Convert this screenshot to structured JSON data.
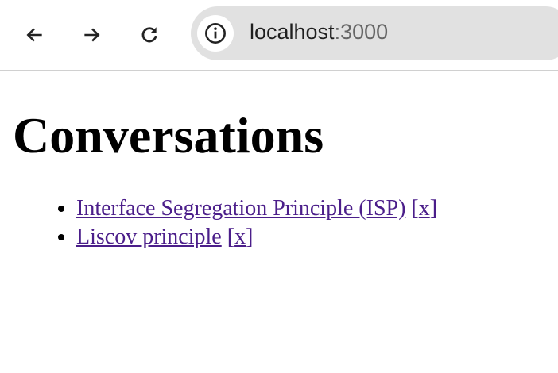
{
  "browser": {
    "url_host": "localhost",
    "url_port": ":3000"
  },
  "page": {
    "title": "Conversations",
    "conversations": [
      {
        "title": "Interface Segregation Principle (ISP)",
        "delete_open": "[",
        "delete_label": "x",
        "delete_close": "]"
      },
      {
        "title": "Liscov principle",
        "delete_open": "[",
        "delete_label": "x",
        "delete_close": "]"
      }
    ]
  },
  "colors": {
    "link": "#4b1e8a"
  }
}
